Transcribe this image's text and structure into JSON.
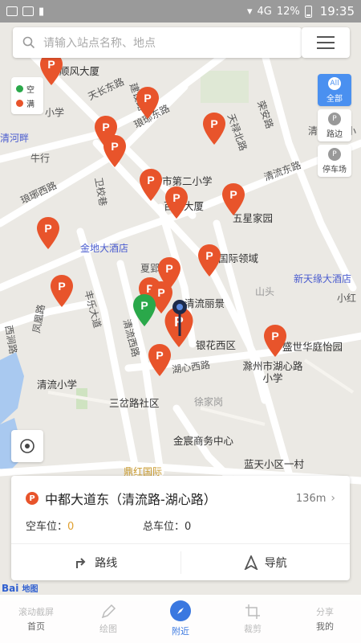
{
  "status_bar": {
    "battery": "12%",
    "time": "19:35",
    "network": "4G"
  },
  "search": {
    "placeholder": "请输入站点名称、地点"
  },
  "legend": {
    "items": [
      {
        "label": "空",
        "color": "#2aa84a"
      },
      {
        "label": "满",
        "color": "#e8542b"
      }
    ]
  },
  "filters": [
    {
      "label": "全部",
      "icon": "All"
    },
    {
      "label": "路边",
      "icon": "P"
    },
    {
      "label": "停车场",
      "icon": "P"
    }
  ],
  "map": {
    "labels": [
      "顺风大厦",
      "天长东路",
      "建设路",
      "琅琊东路",
      "市第二小学",
      "天禄北路",
      "荣安路",
      "清流东路",
      "牛行",
      "卫校巷",
      "琅琊西路",
      "百花大厦",
      "五星家园",
      "金地大酒店",
      "夏郢",
      "国际领域",
      "新天缘大酒店",
      "清流丽景",
      "山头",
      "小红",
      "丰乐大道",
      "清流西路",
      "凤凰路",
      "西涧路",
      "银花西区",
      "盛世华庭怡园",
      "湖心西路",
      "滁州市湖心路小学",
      "清流小学",
      "三岔路社区",
      "徐家岗",
      "金宸商务中心",
      "蓝天小区一村",
      "鼎红国际",
      "清河畔",
      "小学",
      "清",
      "小"
    ]
  },
  "card": {
    "title": "中都大道东（清流路-湖心路）",
    "distance": "136m",
    "empty_label": "空车位：",
    "empty_value": "0",
    "total_label": "总车位：",
    "total_value": "0",
    "route_label": "路线",
    "nav_label": "导航"
  },
  "brand": {
    "logo_text": "Bai",
    "logo_suffix": "地图"
  },
  "bottom_nav": [
    {
      "ghost": "滚动截屏",
      "label": "首页"
    },
    {
      "ghost": "绘图",
      "label": ""
    },
    {
      "ghost": "",
      "label": "附近"
    },
    {
      "ghost": "裁剪",
      "label": ""
    },
    {
      "ghost": "分享",
      "label": "我的"
    }
  ],
  "colors": {
    "accent": "#3a78e0",
    "pin_full": "#e8542b",
    "pin_empty": "#2aa84a"
  }
}
